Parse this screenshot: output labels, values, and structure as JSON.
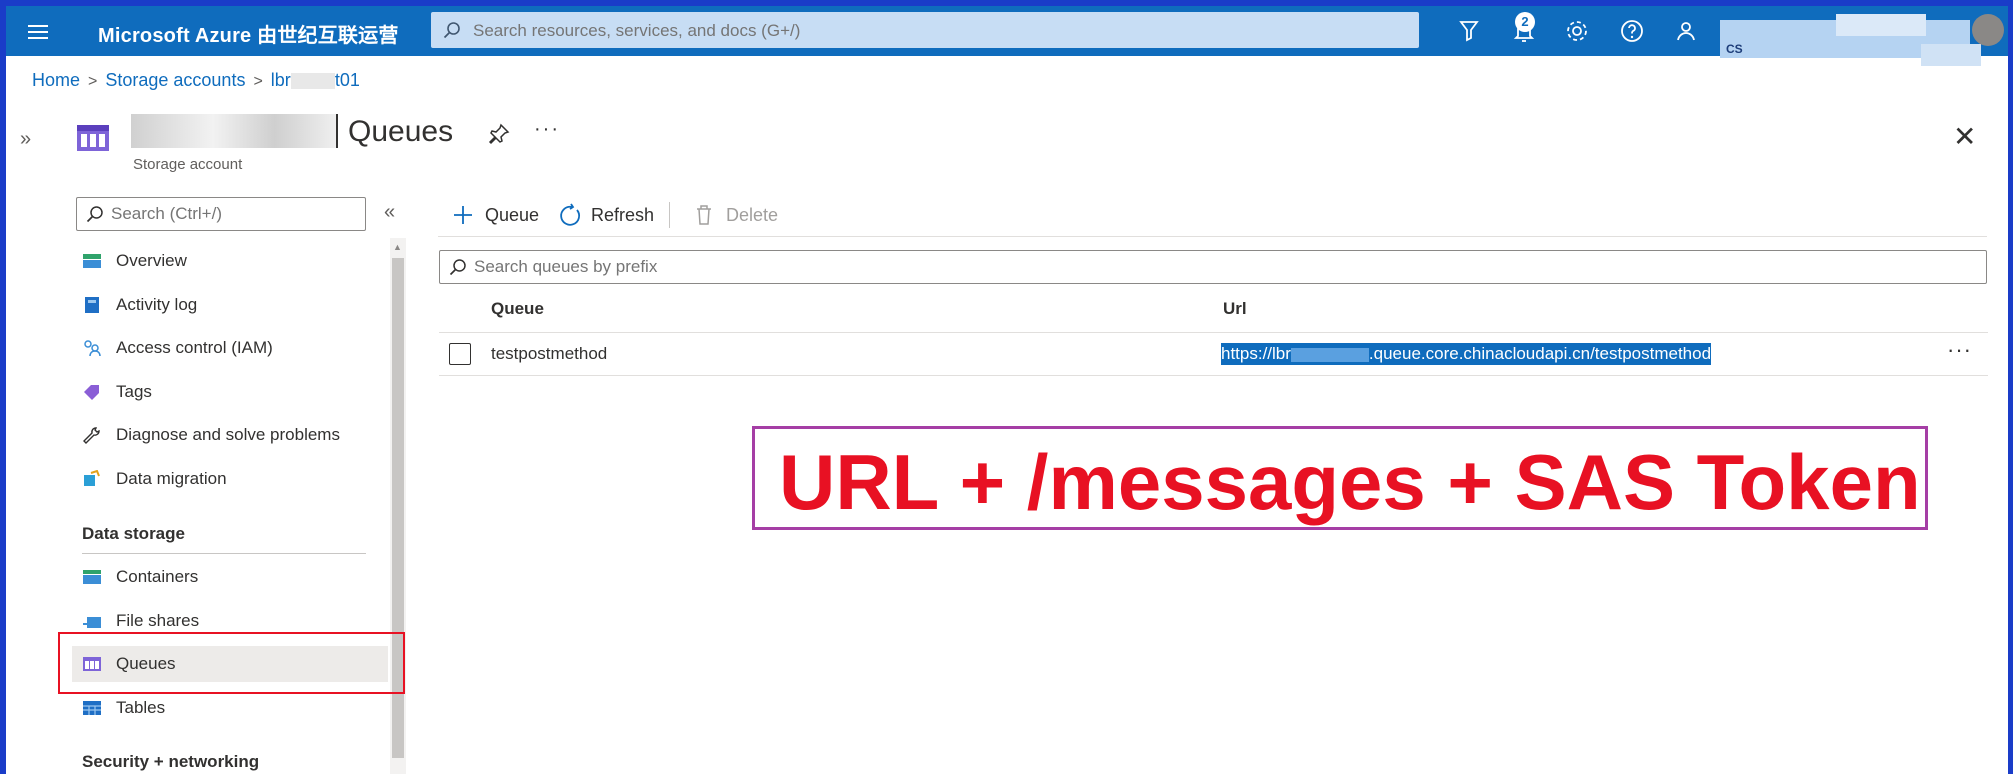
{
  "topbar": {
    "brand": "Microsoft Azure 由世纪互联运营",
    "search_placeholder": "Search resources, services, and docs (G+/)",
    "notification_count": "2",
    "account_text": "CS"
  },
  "breadcrumb": {
    "home": "Home",
    "storage_accounts": "Storage accounts",
    "account_prefix": "lbr",
    "account_suffix": "t01"
  },
  "page": {
    "title": "Queues",
    "subtitle": "Storage account",
    "more": "···",
    "close": "✕"
  },
  "nav": {
    "search_placeholder": "Search (Ctrl+/)",
    "collapse": "«",
    "expand": "»",
    "items": [
      {
        "label": "Overview",
        "icon": "overview-icon"
      },
      {
        "label": "Activity log",
        "icon": "activity-log-icon"
      },
      {
        "label": "Access control (IAM)",
        "icon": "iam-icon"
      },
      {
        "label": "Tags",
        "icon": "tag-icon"
      },
      {
        "label": "Diagnose and solve problems",
        "icon": "wrench-icon"
      },
      {
        "label": "Data migration",
        "icon": "data-migration-icon"
      }
    ],
    "section_data_storage": "Data storage",
    "storage_items": [
      {
        "label": "Containers",
        "icon": "containers-icon"
      },
      {
        "label": "File shares",
        "icon": "file-shares-icon"
      },
      {
        "label": "Queues",
        "icon": "queues-icon"
      },
      {
        "label": "Tables",
        "icon": "tables-icon"
      }
    ],
    "section_security": "Security + networking"
  },
  "toolbar": {
    "add_queue": "Queue",
    "refresh": "Refresh",
    "delete": "Delete"
  },
  "queue_search_placeholder": "Search queues by prefix",
  "table": {
    "columns": [
      "Queue",
      "Url"
    ],
    "rows": [
      {
        "name": "testpostmethod",
        "url_prefix": "https://lbr",
        "url_suffix": ".queue.core.chinacloudapi.cn/testpostmethod"
      }
    ],
    "row_more": "···"
  },
  "annotation": "URL + /messages + SAS Token",
  "colors": {
    "topbar": "#0f6cbd",
    "accent": "#0f6cbd",
    "highlight_box": "#e81123",
    "annotation_text": "#e81123",
    "annotation_border": "#a53ea5"
  }
}
